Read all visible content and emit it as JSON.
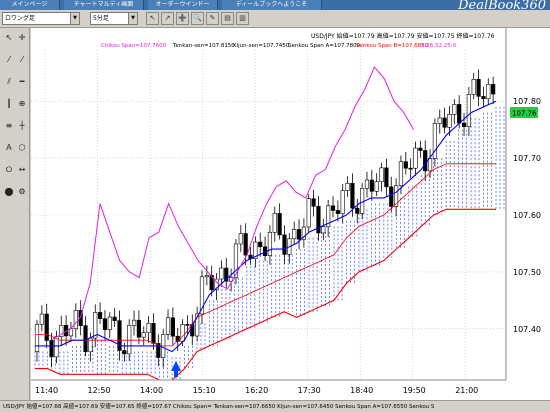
{
  "menu": {
    "tabs": [
      "メインページ",
      "チャートマルティ画面",
      "オーダーウインドー",
      "ディールブックへようこそ"
    ],
    "logo": "DealBook360"
  },
  "toolbar": {
    "symbol_select": "ロワング足",
    "period_select": "5分足",
    "buttons": [
      "↖",
      "↗",
      "➕",
      "🔍",
      "✎",
      "▤",
      "▥"
    ]
  },
  "left_tools": [
    "↖",
    "✛",
    "⁄",
    "⁄",
    "⫽",
    "━",
    "┃",
    "⊕",
    "≡",
    "┼",
    "Ａ",
    "⬡",
    "⭘",
    "↔",
    "⬤",
    "⚙"
  ],
  "chart": {
    "header_line1": "USD/JPY 始値=107.79 高値=107.79 安値=107.75 終値=107.76",
    "header_chikou": "Chikou Span=107.7600",
    "header_tenkan": "Tenkan-sen=107.8150",
    "header_kijun": "Kijun-sen=107.7450",
    "header_senkouA": "Senkou Span A=107.7800",
    "header_senkouB": "Senkou Span B=107.6850",
    "header_date": "9.26,52,25:0",
    "current_price": "107.76",
    "colors": {
      "candle_up": "#ffffff",
      "candle_down": "#000000",
      "chikou": "#e020e0",
      "tenkan": "#0000ff",
      "kijun": "#ff0000",
      "cloud_fill": "#3050ff",
      "price_badge": "#22cc44"
    }
  },
  "chart_data": {
    "type": "candlestick",
    "instrument": "USD/JPY",
    "x_tick_labels": [
      "11:40",
      "12:50",
      "14:00",
      "15:10",
      "16:20",
      "17:30",
      "18:40",
      "19:50",
      "21:00"
    ],
    "y_tick_labels": [
      "107.40",
      "107.50",
      "107.60",
      "107.70",
      "107.80"
    ],
    "ylim": [
      107.31,
      107.89
    ],
    "series": [
      {
        "name": "Chikou Span",
        "values": [
          107.38,
          107.39,
          107.4,
          107.42,
          107.48,
          107.62,
          107.57,
          107.52,
          107.5,
          107.49,
          107.56,
          107.57,
          107.62,
          107.58,
          107.55,
          107.52,
          107.5,
          107.48,
          107.47,
          107.5,
          107.53,
          107.58,
          107.62,
          107.65,
          107.66,
          107.64,
          107.63,
          107.67,
          107.68,
          107.72,
          107.75,
          107.79,
          107.82,
          107.86,
          107.84,
          107.8,
          107.78,
          107.75
        ]
      },
      {
        "name": "Tenkan-sen",
        "values": [
          107.37,
          107.37,
          107.37,
          107.38,
          107.38,
          107.39,
          107.38,
          107.37,
          107.37,
          107.37,
          107.37,
          107.36,
          107.38,
          107.42,
          107.46,
          107.48,
          107.5,
          107.52,
          107.53,
          107.54,
          107.54,
          107.55,
          107.57,
          107.58,
          107.59,
          107.6,
          107.62,
          107.63,
          107.63,
          107.64,
          107.66,
          107.68,
          107.71,
          107.74,
          107.76,
          107.78,
          107.79,
          107.8
        ]
      },
      {
        "name": "Kijun-sen",
        "values": [
          107.39,
          107.39,
          107.38,
          107.38,
          107.38,
          107.38,
          107.38,
          107.38,
          107.38,
          107.38,
          107.37,
          107.37,
          107.39,
          107.42,
          107.43,
          107.44,
          107.45,
          107.46,
          107.47,
          107.48,
          107.49,
          107.5,
          107.51,
          107.52,
          107.53,
          107.56,
          107.58,
          107.59,
          107.6,
          107.62,
          107.64,
          107.66,
          107.68,
          107.69,
          107.69,
          107.69,
          107.69,
          107.69
        ]
      }
    ],
    "current_price": 107.76,
    "grid": true
  },
  "status": "USD/JPY 始値=107.68 高値=107.69 安値=107.65 終値=107.67  Chikou Span=  Tenkan-sen=107.6650 Kijun-sen=107.6450 Senkou Span A=107.6550 Senkou S"
}
